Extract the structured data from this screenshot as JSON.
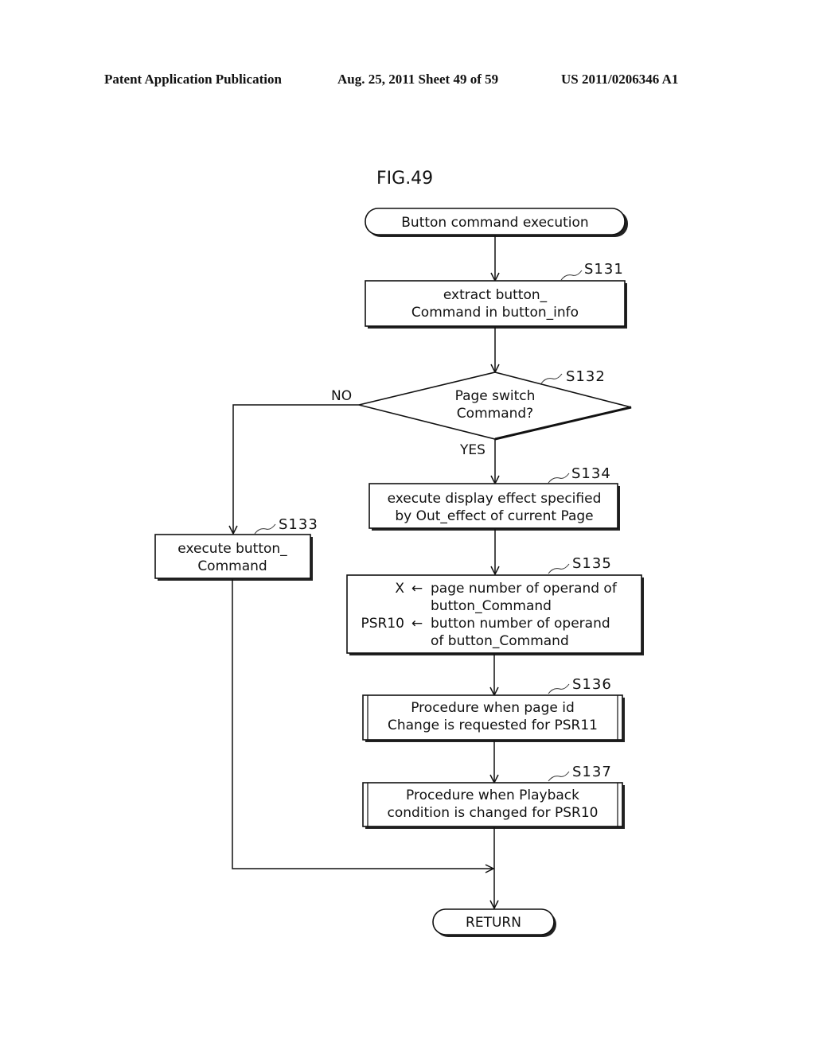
{
  "header": {
    "publication": "Patent Application Publication",
    "date_sheet": "Aug. 25, 2011  Sheet 49 of 59",
    "number": "US 2011/0206346 A1"
  },
  "figure": {
    "title": "FIG.49",
    "start": "Button command execution",
    "end": "RETURN",
    "steps": {
      "s131": {
        "label": "S131",
        "lines": [
          "extract button_",
          "Command in button_info"
        ]
      },
      "s132": {
        "label": "S132",
        "lines": [
          "Page switch",
          "Command?"
        ],
        "yes": "YES",
        "no": "NO"
      },
      "s133": {
        "label": "S133",
        "lines": [
          "execute button_",
          "Command"
        ]
      },
      "s134": {
        "label": "S134",
        "lines": [
          "execute display effect specified",
          "by Out_effect of current Page"
        ]
      },
      "s135": {
        "label": "S135",
        "assignments": [
          {
            "target": "X",
            "arrow": "←",
            "lines": [
              "page number of operand of",
              "button_Command"
            ]
          },
          {
            "target": "PSR10",
            "arrow": "←",
            "lines": [
              "button number of operand",
              "of button_Command"
            ]
          }
        ]
      },
      "s136": {
        "label": "S136",
        "lines": [
          "Procedure when page id",
          "Change is requested for PSR11"
        ]
      },
      "s137": {
        "label": "S137",
        "lines": [
          "Procedure when Playback",
          "condition is changed for PSR10"
        ]
      }
    }
  }
}
